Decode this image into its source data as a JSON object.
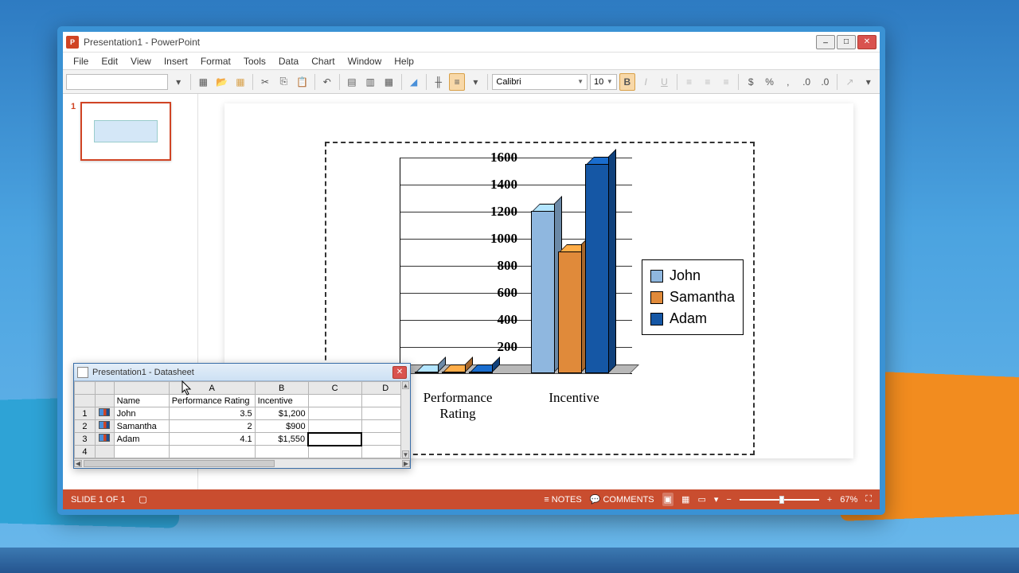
{
  "window": {
    "title": "Presentation1 - PowerPoint"
  },
  "menubar": [
    "File",
    "Edit",
    "View",
    "Insert",
    "Format",
    "Tools",
    "Data",
    "Chart",
    "Window",
    "Help"
  ],
  "toolbar": {
    "font": "Calibri",
    "size": "10"
  },
  "slidepanel": {
    "slides": [
      {
        "num": "1"
      }
    ]
  },
  "chart_data": {
    "type": "bar",
    "categories": [
      "Performance Rating",
      "Incentive"
    ],
    "series": [
      {
        "name": "John",
        "color": "#8fb7df",
        "values": [
          3.5,
          1200
        ]
      },
      {
        "name": "Samantha",
        "color": "#e08a3a",
        "values": [
          2,
          900
        ]
      },
      {
        "name": "Adam",
        "color": "#1557a5",
        "values": [
          4.1,
          1550
        ]
      }
    ],
    "ylim": [
      0,
      1600
    ],
    "y_ticks": [
      200,
      400,
      600,
      800,
      1000,
      1200,
      1400,
      1600
    ]
  },
  "datasheet": {
    "title": "Presentation1 - Datasheet",
    "col_letters": [
      "A",
      "B",
      "C",
      "D"
    ],
    "header_row": [
      "Name",
      "Performance Rating",
      "Incentive"
    ],
    "rows": [
      {
        "n": "1",
        "name": "John",
        "a": "3.5",
        "b": "$1,200"
      },
      {
        "n": "2",
        "name": "Samantha",
        "a": "2",
        "b": "$900"
      },
      {
        "n": "3",
        "name": "Adam",
        "a": "4.1",
        "b": "$1,550"
      },
      {
        "n": "4",
        "name": "",
        "a": "",
        "b": ""
      }
    ]
  },
  "statusbar": {
    "slide_indicator": "SLIDE 1 OF 1",
    "notes": "NOTES",
    "comments": "COMMENTS",
    "zoom": "67%"
  }
}
